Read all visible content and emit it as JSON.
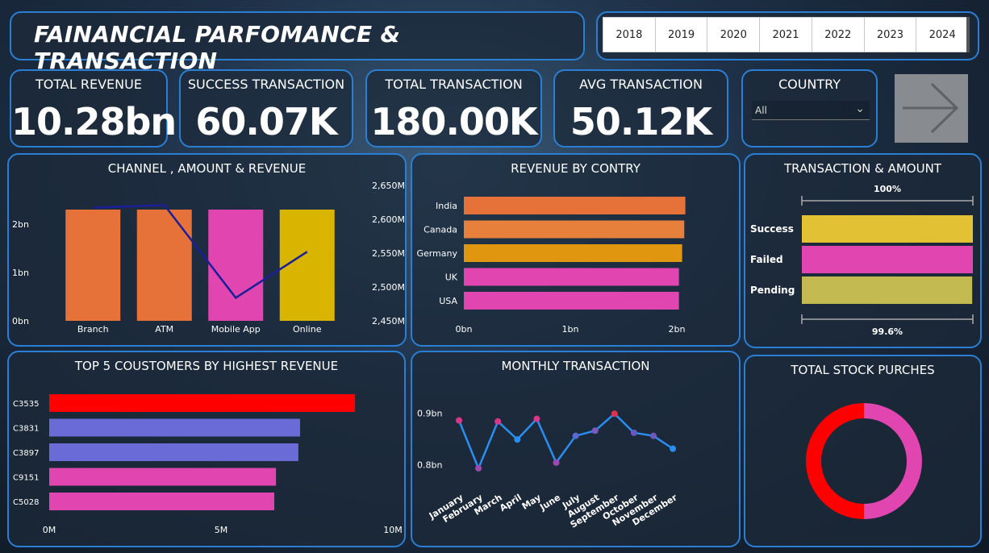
{
  "header": {
    "title": "FAINANCIAL PARFOMANCE & TRANSACTION"
  },
  "year_slicer": {
    "years": [
      "2018",
      "2019",
      "2020",
      "2021",
      "2022",
      "2023",
      "2024"
    ]
  },
  "kpis": [
    {
      "label": "TOTAL REVENUE",
      "value": "10.28bn"
    },
    {
      "label": "SUCCESS TRANSACTION",
      "value": "60.07K"
    },
    {
      "label": "TOTAL TRANSACTION",
      "value": "180.00K"
    },
    {
      "label": "AVG TRANSACTION",
      "value": "50.12K"
    }
  ],
  "country_filter": {
    "label": "COUNTRY",
    "selected": "All"
  },
  "nav": {
    "next_icon": "arrow-right-icon"
  },
  "colors": {
    "orange": "#e6723a",
    "yellow": "#d9b400",
    "pink": "#e045b0",
    "navy": "#1a1f9a",
    "red": "#ff0000",
    "periwinkle": "#6b6bd8",
    "blue_line": "#2a8ef0",
    "panel_border": "#2a7fd4"
  },
  "chart_data": [
    {
      "id": "channel",
      "type": "bar",
      "title": "CHANNEL , AMOUNT & REVENUE",
      "categories": [
        "Branch",
        "ATM",
        "Mobile App",
        "Online"
      ],
      "series": [
        {
          "axis": "left",
          "values": [
            2.3,
            2.3,
            2.3,
            2.3
          ],
          "colors": [
            "#e6723a",
            "#e6723a",
            "#e045b0",
            "#d9b400"
          ]
        },
        {
          "type": "line",
          "axis": "right",
          "values": [
            2617,
            2621,
            2484,
            2552
          ],
          "color": "#1a1f9a"
        }
      ],
      "y_ticks": [
        "0bn",
        "1bn",
        "2bn"
      ],
      "ylim": [
        0,
        2.8
      ],
      "y2_ticks": [
        "2,450M",
        "2,500M",
        "2,550M",
        "2,600M",
        "2,650M"
      ],
      "y2lim": [
        2450,
        2650
      ]
    },
    {
      "id": "country",
      "type": "bar",
      "orientation": "horizontal",
      "title": "REVENUE BY CONTRY",
      "categories": [
        "India",
        "Canada",
        "Germany",
        "UK",
        "USA"
      ],
      "values": [
        2.08,
        2.07,
        2.05,
        2.02,
        2.02
      ],
      "colors": [
        "#e6723a",
        "#e6803a",
        "#e0960e",
        "#e045b0",
        "#e045b0"
      ],
      "x_ticks": [
        "0bn",
        "1bn",
        "2bn"
      ],
      "xlim": [
        0,
        2.0
      ]
    },
    {
      "id": "transaction",
      "type": "bar",
      "orientation": "horizontal",
      "title": "TRANSACTION & AMOUNT",
      "categories": [
        "Success",
        "Failed",
        "Pending"
      ],
      "values": [
        100,
        100,
        99.6
      ],
      "colors": [
        "#e2c234",
        "#e045b0",
        "#c3bb52"
      ],
      "top_label": "100%",
      "bottom_label": "99.6%"
    },
    {
      "id": "customers",
      "type": "bar",
      "orientation": "horizontal",
      "title": "TOP 5 COUSTOMERS BY HIGHEST REVENUE",
      "categories": [
        "C3535",
        "C3831",
        "C3897",
        "C9151",
        "C5028"
      ],
      "values": [
        8.9,
        7.3,
        7.25,
        6.6,
        6.55
      ],
      "colors": [
        "#ff0000",
        "#6b6bd8",
        "#6b6bd8",
        "#e045b0",
        "#e045b0"
      ],
      "x_ticks": [
        "0M",
        "5M",
        "10M"
      ],
      "xlim": [
        0,
        10
      ]
    },
    {
      "id": "monthly",
      "type": "line",
      "title": "MONTHLY TRANSACTION",
      "categories": [
        "January",
        "February",
        "March",
        "April",
        "May",
        "June",
        "July",
        "August",
        "September",
        "October",
        "November",
        "December"
      ],
      "values": [
        0.886,
        0.793,
        0.884,
        0.849,
        0.889,
        0.804,
        0.856,
        0.866,
        0.899,
        0.862,
        0.856,
        0.831
      ],
      "point_colors": [
        "#d8388a",
        "#9b4bb0",
        "#d8388a",
        "#2a8ef0",
        "#d8388a",
        "#9b4bb0",
        "#5a6ad0",
        "#7a5ac0",
        "#e03050",
        "#6a5ac0",
        "#6a5ac0",
        "#2a8ef0"
      ],
      "y_ticks": [
        "0.8bn",
        "0.9bn"
      ],
      "ylim": [
        0.76,
        0.94
      ]
    },
    {
      "id": "stock",
      "type": "pie",
      "title": "TOTAL STOCK PURCHES",
      "values": [
        50,
        50
      ],
      "colors": [
        "#e045b0",
        "#ff0000"
      ],
      "donut": true
    }
  ]
}
